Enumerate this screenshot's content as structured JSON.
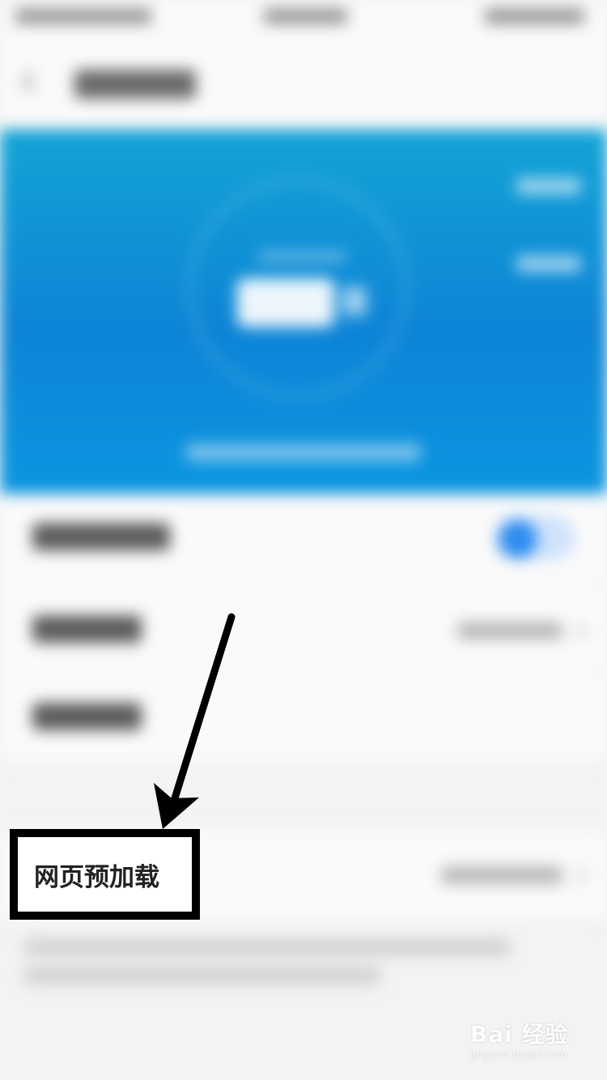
{
  "callout": {
    "label": "网页预加载"
  },
  "settings": {
    "web_preload_toggle_on": true,
    "highlighted_setting": "网页预加载"
  },
  "watermark": {
    "brand": "Bai 经验",
    "url": "jingyan.baidu.com"
  },
  "colors": {
    "hero_blue": "#0d84d6",
    "toggle_blue": "#2d8cf0",
    "annotation_black": "#000000"
  }
}
